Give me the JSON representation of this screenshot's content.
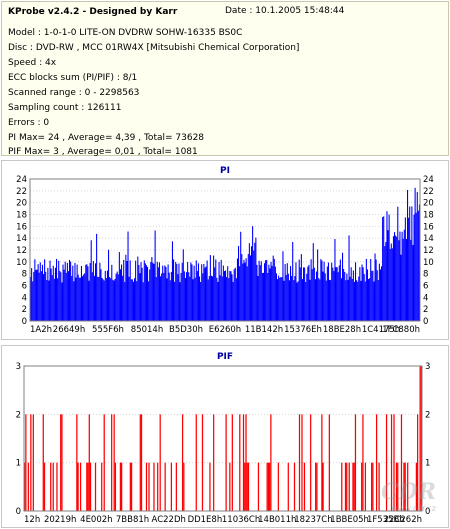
{
  "info": {
    "title": "KProbe v2.4.2 - Designed by Karr",
    "date": "Date : 10.1.2005 15:48:44",
    "lines": [
      "Model : 1-0-1-0 LITE-ON DVDRW SOHW-16335 BS0C",
      "Disc : DVD-RW , MCC 01RW4X  [Mitsubishi Chemical Corporation]",
      "Speed : 4x",
      "ECC blocks sum (PI/PIF) : 8/1",
      "Scanned range : 0 - 2298563",
      "Sampling count : 126111",
      "Errors : 0",
      "PI Max= 24 , Average= 4,39 , Total= 73628",
      "PIF Max= 3 , Average= 0,01 , Total= 1081"
    ]
  },
  "watermark": {
    "text": "CDR",
    "sub": "www.cdr.cz"
  },
  "chart_data": [
    {
      "type": "bar",
      "title": "PI",
      "color": "#0000ff",
      "ylim": [
        0,
        24
      ],
      "yticks": [
        0,
        2,
        4,
        6,
        8,
        10,
        12,
        14,
        16,
        18,
        20,
        22,
        24
      ],
      "xtick_labels": [
        "1A2h",
        "26649h",
        "555F6h",
        "85014h",
        "B5D30h",
        "E6260h",
        "11B142h",
        "15376Eh",
        "18BE28h",
        "1C4175h",
        "1FC880h"
      ],
      "grid": true
    },
    {
      "type": "bar",
      "title": "PIF",
      "color": "#ff0000",
      "ylim": [
        0,
        3
      ],
      "yticks": [
        0,
        1,
        2,
        3
      ],
      "xtick_labels": [
        "12h",
        "20219h",
        "4E002h",
        "7BB81h",
        "AC22Dh",
        "DD1E8h",
        "11036Ch",
        "14B011h",
        "18237Ch",
        "1BBE05h",
        "1F535Bh",
        "22C262h"
      ],
      "grid": true
    }
  ]
}
